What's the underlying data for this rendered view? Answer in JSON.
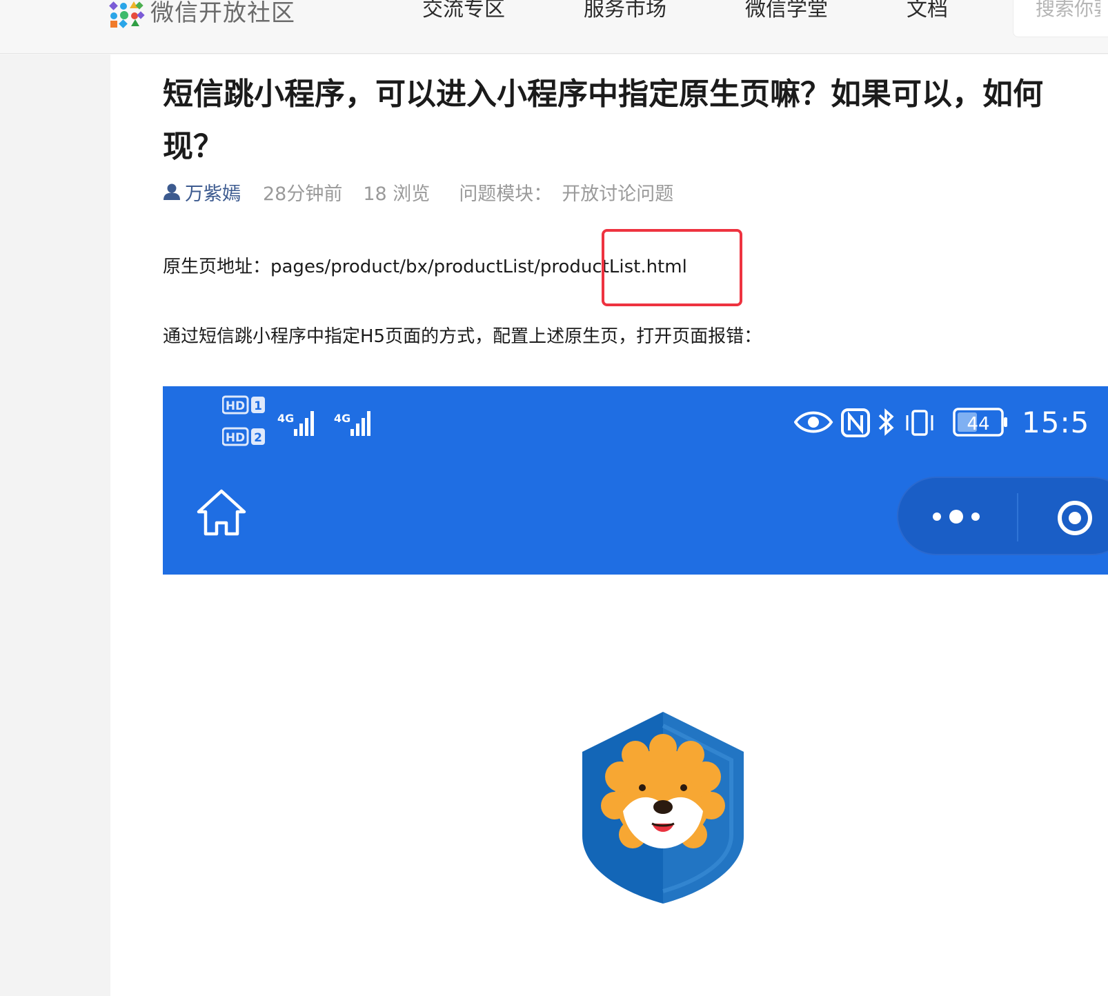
{
  "nav": {
    "logo_text": "微信开放社区",
    "items": [
      "交流专区",
      "服务市场",
      "微信学堂",
      "文档"
    ],
    "search_placeholder": "搜索你要"
  },
  "question": {
    "title_line1": "短信跳小程序，可以进入小程序中指定原生页嘛？如果可以，如何",
    "title_line2": "现？",
    "author": "万紫嫣",
    "time": "28分钟前",
    "views": "18 浏览",
    "module_label": "问题模块：",
    "module_value": "开放讨论问题",
    "para1": "原生页地址：pages/product/bx/productList/productList.html",
    "para2": "通过短信跳小程序中指定H5页面的方式，配置上述原生页，打开页面报错："
  },
  "screenshot": {
    "status_hd1": "HD",
    "status_hd2": "HD",
    "status_sim1": "1",
    "status_sim2": "2",
    "network1": "4G",
    "network2": "4G",
    "battery": "44",
    "time": "15:5"
  },
  "colors": {
    "accent_blue": "#1f6ee3",
    "highlight_red": "#ee3340",
    "author_blue": "#3c5a8f"
  }
}
